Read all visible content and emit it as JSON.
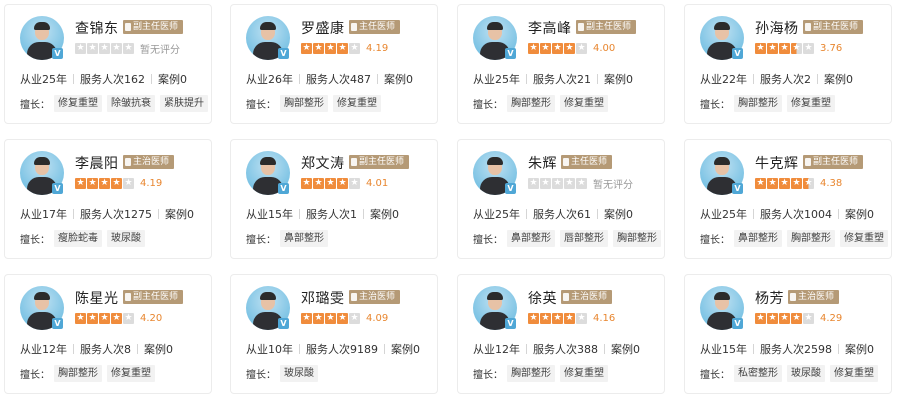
{
  "doctors": [
    {
      "name": "查锦东",
      "title": "副主任医师",
      "stars": 0,
      "score": "暂无评分",
      "years": "从业25年",
      "served": "服务人次162",
      "cases": "案例0",
      "spec_label": "擅长：",
      "tags": [
        "修复重塑",
        "除皱抗衰",
        "紧肤提升"
      ]
    },
    {
      "name": "罗盛康",
      "title": "主任医师",
      "stars": 4,
      "score": "4.19",
      "years": "从业26年",
      "served": "服务人次487",
      "cases": "案例0",
      "spec_label": "擅长：",
      "tags": [
        "胸部整形",
        "修复重塑"
      ]
    },
    {
      "name": "李高峰",
      "title": "副主任医师",
      "stars": 4,
      "score": "4.00",
      "years": "从业25年",
      "served": "服务人次21",
      "cases": "案例0",
      "spec_label": "擅长：",
      "tags": [
        "胸部整形",
        "修复重塑"
      ]
    },
    {
      "name": "孙海杨",
      "title": "副主任医师",
      "stars": 3.5,
      "score": "3.76",
      "years": "从业22年",
      "served": "服务人次2",
      "cases": "案例0",
      "spec_label": "擅长：",
      "tags": [
        "胸部整形",
        "修复重塑"
      ]
    },
    {
      "name": "李晨阳",
      "title": "主治医师",
      "stars": 4,
      "score": "4.19",
      "years": "从业17年",
      "served": "服务人次1275",
      "cases": "案例0",
      "spec_label": "擅长：",
      "tags": [
        "瘦脸蛇毒",
        "玻尿酸"
      ]
    },
    {
      "name": "郑文涛",
      "title": "副主任医师",
      "stars": 4,
      "score": "4.01",
      "years": "从业15年",
      "served": "服务人次1",
      "cases": "案例0",
      "spec_label": "擅长：",
      "tags": [
        "鼻部整形"
      ]
    },
    {
      "name": "朱辉",
      "title": "主任医师",
      "stars": 0,
      "score": "暂无评分",
      "years": "从业25年",
      "served": "服务人次61",
      "cases": "案例0",
      "spec_label": "擅长：",
      "tags": [
        "鼻部整形",
        "唇部整形",
        "胸部整形"
      ]
    },
    {
      "name": "牛克辉",
      "title": "副主任医师",
      "stars": 4.5,
      "score": "4.38",
      "years": "从业25年",
      "served": "服务人次1004",
      "cases": "案例0",
      "spec_label": "擅长：",
      "tags": [
        "鼻部整形",
        "胸部整形",
        "修复重塑"
      ]
    },
    {
      "name": "陈星光",
      "title": "副主任医师",
      "stars": 4,
      "score": "4.20",
      "years": "从业12年",
      "served": "服务人次8",
      "cases": "案例0",
      "spec_label": "擅长：",
      "tags": [
        "胸部整形",
        "修复重塑"
      ]
    },
    {
      "name": "邓璐雯",
      "title": "主治医师",
      "stars": 4,
      "score": "4.09",
      "years": "从业10年",
      "served": "服务人次9189",
      "cases": "案例0",
      "spec_label": "擅长：",
      "tags": [
        "玻尿酸"
      ]
    },
    {
      "name": "徐英",
      "title": "主治医师",
      "stars": 4,
      "score": "4.16",
      "years": "从业12年",
      "served": "服务人次388",
      "cases": "案例0",
      "spec_label": "擅长：",
      "tags": [
        "胸部整形",
        "修复重塑"
      ]
    },
    {
      "name": "杨芳",
      "title": "主治医师",
      "stars": 4,
      "score": "4.29",
      "years": "从业15年",
      "served": "服务人次2598",
      "cases": "案例0",
      "spec_label": "擅长：",
      "tags": [
        "私密整形",
        "玻尿酸",
        "修复重塑"
      ]
    }
  ],
  "colors": {
    "star_on": "#f08c3c",
    "star_off": "#dcdcdc",
    "title_tag": "#b59a76",
    "score": "#e8862f",
    "verified_badge": "#4fa7d6"
  },
  "icons": {
    "verified": "v-badge-icon",
    "star": "star-icon",
    "title": "doctor-title-icon"
  },
  "verified_char": "V"
}
